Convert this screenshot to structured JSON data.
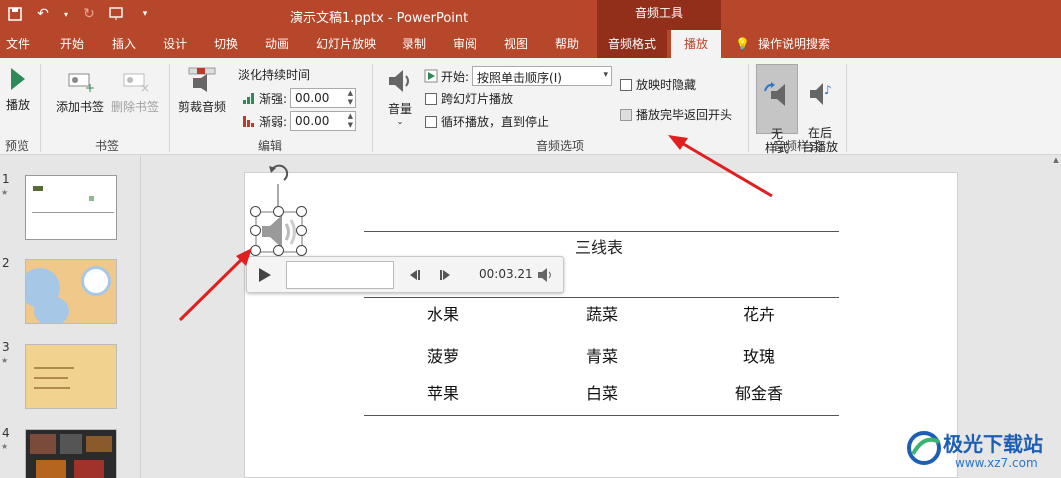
{
  "titlebar": {
    "doc_title": "演示文稿1.pptx  -  PowerPoint",
    "context_group": "音频工具"
  },
  "tabs": [
    "文件",
    "开始",
    "插入",
    "设计",
    "切换",
    "动画",
    "幻灯片放映",
    "录制",
    "审阅",
    "视图",
    "帮助"
  ],
  "context_tabs": [
    "音频格式",
    "播放"
  ],
  "tell_me": "操作说明搜索",
  "ribbon": {
    "preview": {
      "play": "播放",
      "group": "预览"
    },
    "bookmarks": {
      "add": "添加书签",
      "remove": "删除书签",
      "group": "书签"
    },
    "editing": {
      "trim": "剪裁音频",
      "fade_title": "淡化持续时间",
      "fade_in_label": "渐强:",
      "fade_in_value": "00.00",
      "fade_out_label": "渐弱:",
      "fade_out_value": "00.00",
      "group": "编辑"
    },
    "audio_options": {
      "volume": "音量",
      "start_label": "开始:",
      "start_value": "按照单击顺序(I)",
      "across_slides": "跨幻灯片播放",
      "loop": "循环播放，直到停止",
      "hide": "放映时隐藏",
      "rewind": "播放完毕返回开头",
      "group": "音频选项"
    },
    "audio_styles": {
      "no_style": "无\n样式",
      "background": "在后\n台播放",
      "group": "音频样式"
    }
  },
  "thumbnails": [
    {
      "num": "1",
      "star": "★"
    },
    {
      "num": "2",
      "star": ""
    },
    {
      "num": "3",
      "star": "★"
    },
    {
      "num": "4",
      "star": "★"
    }
  ],
  "slide": {
    "caption": "三线表",
    "rows": [
      [
        "水果",
        "蔬菜",
        "花卉"
      ],
      [
        "菠萝",
        "青菜",
        "玫瑰"
      ],
      [
        "苹果",
        "白菜",
        "郁金香"
      ]
    ]
  },
  "player": {
    "time": "00:03.21"
  },
  "watermark": {
    "main": "极光下载站",
    "sub": "www.xz7.com"
  },
  "colors": {
    "accent": "#b7472a",
    "context": "#922f1b",
    "arrow": "#e02020"
  }
}
